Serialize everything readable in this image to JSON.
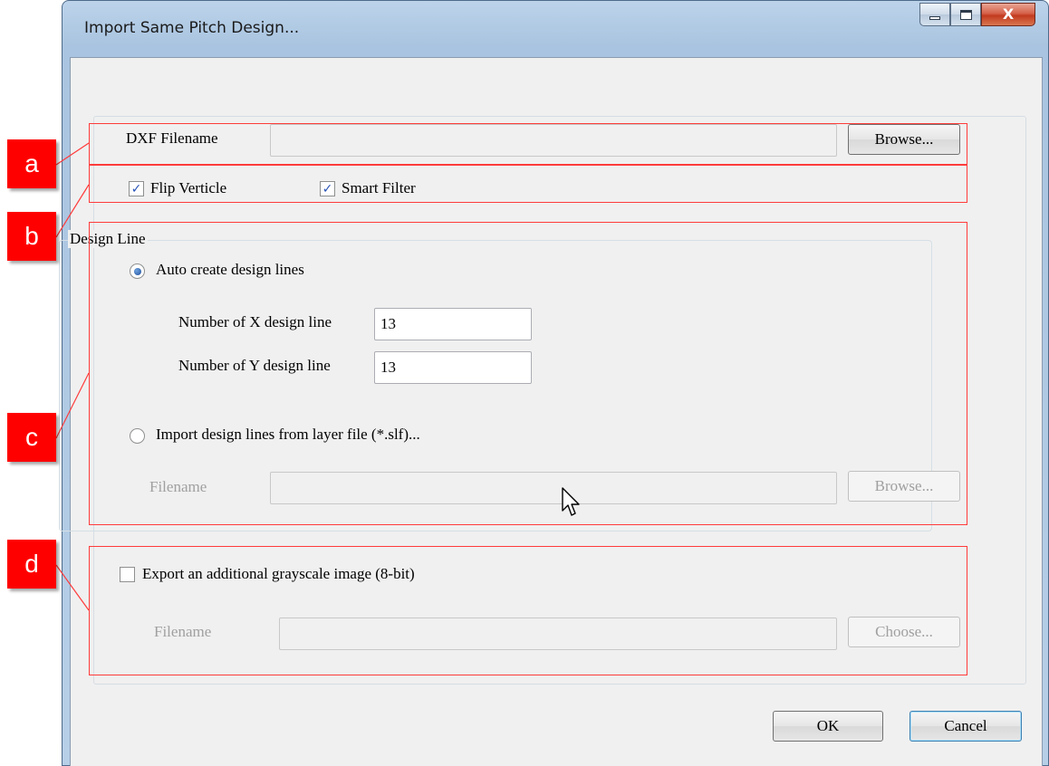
{
  "window": {
    "title": "Import Same Pitch Design..."
  },
  "caption": {
    "close_glyph": "X"
  },
  "dxf": {
    "label": "DXF Filename",
    "value": "",
    "browse_label": "Browse..."
  },
  "options": {
    "flip_label": "Flip Verticle",
    "flip_checked": true,
    "smart_label": "Smart Filter",
    "smart_checked": true
  },
  "design_line": {
    "group_title": "Design Line",
    "auto_label": "Auto create design lines",
    "auto_selected": true,
    "x_label": "Number of X design line",
    "x_value": "13",
    "y_label": "Number of Y design line",
    "y_value": "13",
    "import_label": "Import design lines from layer file (*.slf)...",
    "import_selected": false,
    "filename_label": "Filename",
    "filename_value": "",
    "browse_label": "Browse..."
  },
  "export": {
    "checkbox_label": "Export an additional grayscale  image (8-bit)",
    "checked": false,
    "filename_label": "Filename",
    "filename_value": "",
    "choose_label": "Choose..."
  },
  "footer": {
    "ok_label": "OK",
    "cancel_label": "Cancel"
  },
  "annotations": {
    "a": "a",
    "b": "b",
    "c": "c",
    "d": "d"
  },
  "colors": {
    "annotation": "#ff0000",
    "check": "#2a55b8",
    "disabled_text": "#a0a0a0"
  }
}
